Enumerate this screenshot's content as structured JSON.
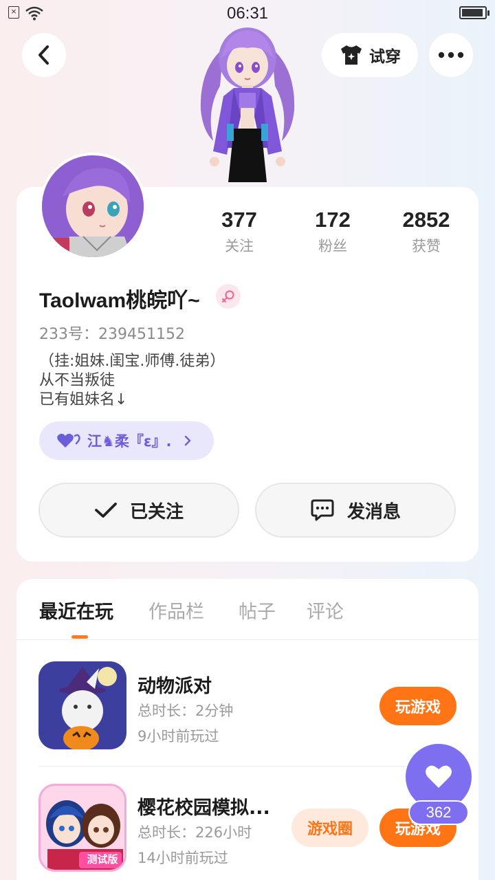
{
  "status_bar": {
    "time": "06:31",
    "sim_icon": "sim-off-icon",
    "wifi_icon": "wifi-icon",
    "battery_icon": "battery-icon"
  },
  "header": {
    "back_icon": "chevron-left-icon",
    "try_on_label": "试穿",
    "try_on_icon": "shirt-sparkle-icon",
    "more_icon": "more-horizontal-icon"
  },
  "profile": {
    "stats": [
      {
        "value": "377",
        "label": "关注"
      },
      {
        "value": "172",
        "label": "粉丝"
      },
      {
        "value": "2852",
        "label": "获赞"
      }
    ],
    "username": "Taolwam桃皖吖~",
    "gender_icon": "female-icon",
    "uid": "233号：239451152",
    "bio": [
      "（挂:姐妹.闺宝.师傅.徒弟）",
      "从不当叛徒",
      "已有姐妹名↓"
    ],
    "friend_chip": {
      "icon": "double-heart-icon",
      "label": "江♞柔『ε』.",
      "chevron": "chevron-right-icon"
    },
    "follow_button": {
      "label": "已关注",
      "icon": "check-icon"
    },
    "message_button": {
      "label": "发消息",
      "icon": "chat-bubble-icon"
    }
  },
  "tabs": [
    {
      "label": "最近在玩",
      "active": true
    },
    {
      "label": "作品栏",
      "active": false
    },
    {
      "label": "帖子",
      "active": false
    },
    {
      "label": "评论",
      "active": false
    }
  ],
  "games": [
    {
      "title": "动物派对",
      "duration": "总时长：2分钟",
      "last_played": "9小时前玩过",
      "play_label": "玩游戏"
    },
    {
      "title": "樱花校园模拟...",
      "duration": "总时长：226小时",
      "last_played": "14小时前玩过",
      "play_label": "玩游戏",
      "circle_label": "游戏圈",
      "icon_badge": "测试版"
    }
  ],
  "like_fab": {
    "icon": "heart-icon",
    "count": "362"
  },
  "colors": {
    "accent_orange": "#ff7415",
    "accent_purple": "#7e6ff1",
    "chip_bg": "#e9e7fb"
  }
}
